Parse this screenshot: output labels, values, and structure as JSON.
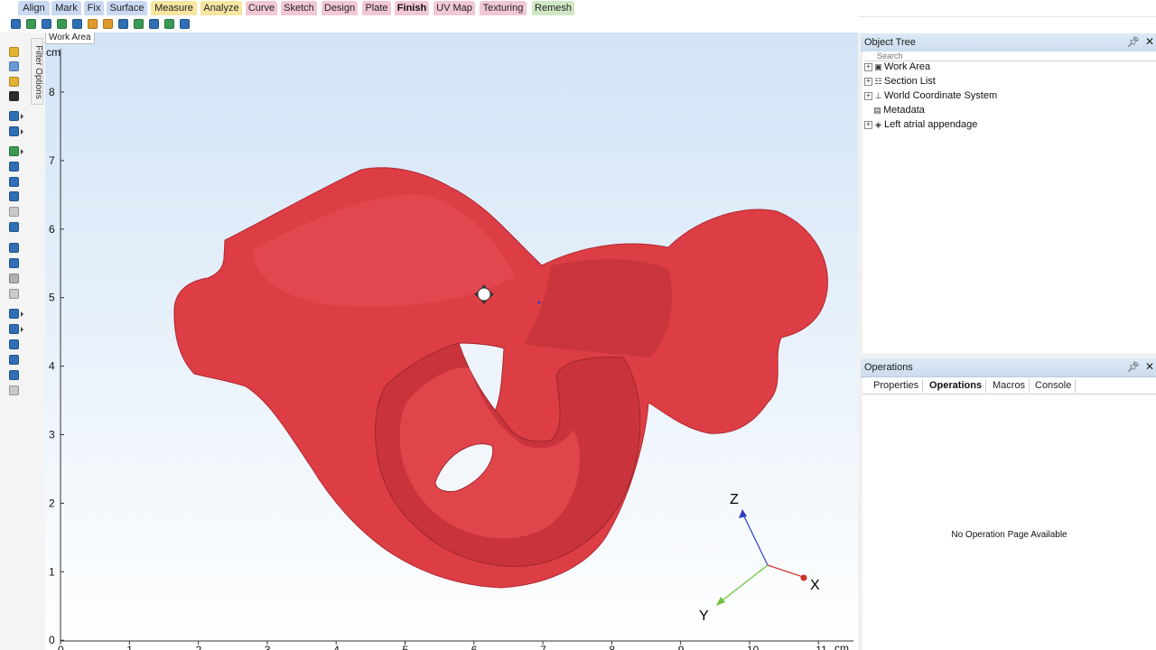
{
  "menu": {
    "tabs": [
      {
        "label": "Align",
        "color": "#c9d9f2",
        "bold": false
      },
      {
        "label": "Mark",
        "color": "#c9d9f2",
        "bold": false
      },
      {
        "label": "Fix",
        "color": "#c9d9f2",
        "bold": false
      },
      {
        "label": "Surface",
        "color": "#c9d9f2",
        "bold": false
      },
      {
        "label": "Measure",
        "color": "#f7e6a0",
        "bold": false
      },
      {
        "label": "Analyze",
        "color": "#f7e6a0",
        "bold": false
      },
      {
        "label": "Curve",
        "color": "#f2c8d4",
        "bold": false
      },
      {
        "label": "Sketch",
        "color": "#f2c8d4",
        "bold": false
      },
      {
        "label": "Design",
        "color": "#f2c8d4",
        "bold": false
      },
      {
        "label": "Plate",
        "color": "#f2c8d4",
        "bold": false
      },
      {
        "label": "Finish",
        "color": "#f2c8d4",
        "bold": true
      },
      {
        "label": "UV Map",
        "color": "#f2c8d4",
        "bold": false
      },
      {
        "label": "Texturing",
        "color": "#f2c8d4",
        "bold": false
      },
      {
        "label": "Remesh",
        "color": "#cfe8c4",
        "bold": false
      }
    ]
  },
  "toolbar": {
    "icons": [
      {
        "name": "new-file-icon",
        "color": "#2e6fb5"
      },
      {
        "name": "import-icon",
        "color": "#3a9a52"
      },
      {
        "name": "save-icon",
        "color": "#2e6fb5"
      },
      {
        "name": "export-icon",
        "color": "#3a9a52"
      },
      {
        "name": "transform-icon",
        "color": "#2e6fb5"
      },
      {
        "name": "align-icon",
        "color": "#e09a2a"
      },
      {
        "name": "mesh-tool-icon",
        "color": "#e09a2a"
      },
      {
        "name": "scale-icon",
        "color": "#2e6fb5"
      },
      {
        "name": "sculpt-icon",
        "color": "#3a9a52"
      },
      {
        "name": "rotate-icon",
        "color": "#2e6fb5"
      },
      {
        "name": "measure-ruler-icon",
        "color": "#3a9a52"
      },
      {
        "name": "remesh-icon",
        "color": "#2e6fb5"
      }
    ]
  },
  "left_toolbar": {
    "filter_label": "Filter Options",
    "icons": [
      {
        "name": "open-folder-icon",
        "color": "#e3b230",
        "arrow": false
      },
      {
        "name": "new-document-icon",
        "color": "#6a9ad6",
        "arrow": false
      },
      {
        "name": "open-file-icon",
        "color": "#e3b230",
        "arrow": false
      },
      {
        "name": "save-disk-icon",
        "color": "#2b2b2b",
        "arrow": false
      },
      {
        "name": "undo-icon",
        "color": "#2e6fb5",
        "arrow": true
      },
      {
        "name": "redo-icon",
        "color": "#2e6fb5",
        "arrow": true
      },
      {
        "name": "select-icon",
        "color": "#3a9a52",
        "arrow": true
      },
      {
        "name": "pan-icon",
        "color": "#2e6fb5",
        "arrow": false
      },
      {
        "name": "rotate-view-icon",
        "color": "#2e6fb5",
        "arrow": false
      },
      {
        "name": "zoom-icon",
        "color": "#2e6fb5",
        "arrow": false
      },
      {
        "name": "zoom-out-icon",
        "color": "#c9c9c9",
        "arrow": false
      },
      {
        "name": "zoom-fit-icon",
        "color": "#2e6fb5",
        "arrow": false
      },
      {
        "name": "view-cube-icon",
        "color": "#2e6fb5",
        "arrow": false
      },
      {
        "name": "shading-icon",
        "color": "#2e6fb5",
        "arrow": false
      },
      {
        "name": "texture-icon",
        "color": "#b0b0b0",
        "arrow": false
      },
      {
        "name": "wireframe-icon",
        "color": "#c9c9c9",
        "arrow": false
      },
      {
        "name": "display-mode-icon",
        "color": "#2e6fb5",
        "arrow": true
      },
      {
        "name": "sphere-render-icon",
        "color": "#2e6fb5",
        "arrow": true
      },
      {
        "name": "lighting-icon",
        "color": "#2e6fb5",
        "arrow": false
      },
      {
        "name": "axis-display-icon",
        "color": "#2e6fb5",
        "arrow": false
      },
      {
        "name": "ruler-display-icon",
        "color": "#2e6fb5",
        "arrow": false
      },
      {
        "name": "grid-display-icon",
        "color": "#c9c9c9",
        "arrow": false
      }
    ]
  },
  "viewport": {
    "tab_label": "Work Area",
    "unit_label": "cm",
    "y_ticks": [
      "8",
      "7",
      "6",
      "5",
      "4",
      "3",
      "2",
      "1",
      "0"
    ],
    "x_ticks": [
      "0",
      "1",
      "2",
      "3",
      "4",
      "5",
      "6",
      "7",
      "8",
      "9",
      "10",
      "11"
    ],
    "x_unit_label": "cm",
    "model_color": "#dd3d44",
    "model_label": "Left atrial appendage",
    "triad": {
      "z_label": "Z",
      "z_color": "#2b3fc4",
      "x_label": "X",
      "x_color": "#d0302b",
      "y_label": "Y",
      "y_color": "#6dc23a"
    }
  },
  "object_tree": {
    "title": "Object Tree",
    "search_placeholder": "Search",
    "items": [
      {
        "label": "Work Area",
        "icon": "work-area-icon",
        "expander": "+",
        "icon_char": "▣",
        "indent": 0
      },
      {
        "label": "Section List",
        "icon": "section-list-icon",
        "expander": "+",
        "icon_char": "☷",
        "indent": 0
      },
      {
        "label": "World Coordinate System",
        "icon": "coordinate-system-icon",
        "expander": "+",
        "icon_char": "⊥",
        "indent": 0
      },
      {
        "label": "Metadata",
        "icon": "metadata-icon",
        "expander": "",
        "icon_char": "▤",
        "indent": 1
      },
      {
        "label": "Left atrial appendage",
        "icon": "mesh-object-icon",
        "expander": "+",
        "icon_char": "◈",
        "indent": 0
      }
    ]
  },
  "operations": {
    "title": "Operations",
    "tabs": [
      {
        "label": "Properties",
        "active": false
      },
      {
        "label": "Operations",
        "active": true
      },
      {
        "label": "Macros",
        "active": false
      },
      {
        "label": "Console",
        "active": false
      }
    ],
    "empty_message": "No Operation Page Available"
  }
}
